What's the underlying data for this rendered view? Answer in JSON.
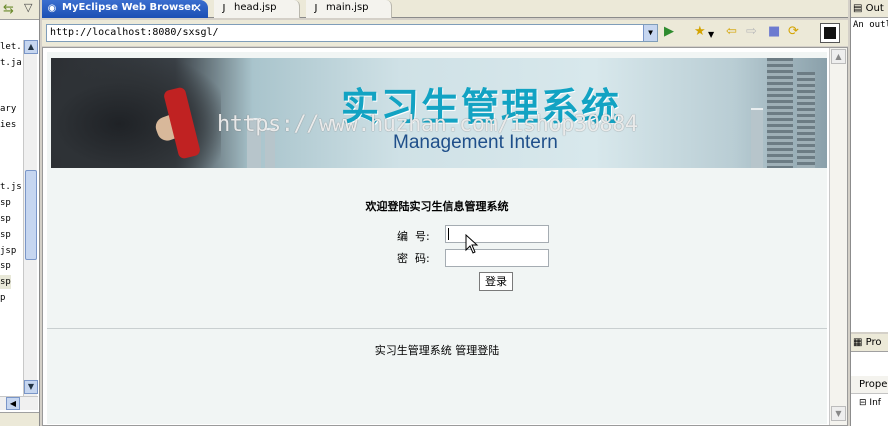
{
  "left_panel": {
    "tree_items": [
      "let.",
      "t.ja",
      "ary",
      "ies",
      "t.js",
      "sp",
      "sp",
      "sp",
      "jsp",
      "sp",
      "sp",
      "p"
    ]
  },
  "editor_tabs": [
    {
      "label": "MyEclipse Web Browser",
      "icon": "globe-icon",
      "active": true
    },
    {
      "label": "head.jsp",
      "icon": "jsp-file-icon",
      "active": false
    },
    {
      "label": "main.jsp",
      "icon": "jsp-file-icon",
      "active": false
    }
  ],
  "browser": {
    "url": "http://localhost:8080/sxsgl/"
  },
  "page": {
    "banner_title": "实习生管理系统",
    "banner_subtitle": "Management Intern",
    "watermark": "https://www.huzhan.com/ishop30884",
    "welcome": "欢迎登陆实习生信息管理系统",
    "id_label": "编  号:",
    "password_label": "密  码:",
    "id_value": "",
    "password_value": "",
    "login_button": "登录",
    "footer": "实习生管理系统 管理登陆"
  },
  "right_panel": {
    "outline_title": "Out",
    "outline_text": "An outl",
    "properties_tab": "Pro",
    "properties_header": "Prope",
    "properties_row": "Inf"
  },
  "colors": {
    "tab_active": "#1b4fb4",
    "banner_title": "#12a3c3",
    "banner_subtitle": "#1f4f8a"
  }
}
